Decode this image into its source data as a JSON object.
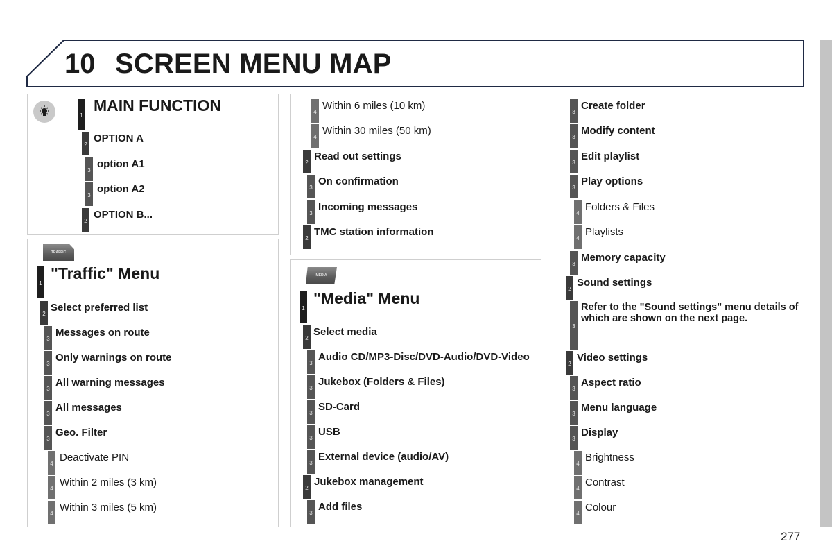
{
  "header": {
    "chapter_number": "10",
    "title": "SCREEN MENU MAP"
  },
  "legend_panel": {
    "icon": "lightbulb-icon",
    "items": [
      {
        "level": "1",
        "label": "MAIN FUNCTION"
      },
      {
        "level": "2",
        "label": "OPTION A"
      },
      {
        "level": "3",
        "label": "option A1"
      },
      {
        "level": "3",
        "label": "option A2"
      },
      {
        "level": "2",
        "label": "OPTION B..."
      }
    ]
  },
  "traffic_panel": {
    "badge": "TRAFFIC",
    "items": [
      {
        "level": "1",
        "label": "\"Traffic\" Menu"
      },
      {
        "level": "2",
        "label": "Select preferred list"
      },
      {
        "level": "3",
        "label": "Messages on route"
      },
      {
        "level": "3",
        "label": "Only warnings on route"
      },
      {
        "level": "3",
        "label": "All warning messages"
      },
      {
        "level": "3",
        "label": "All messages"
      },
      {
        "level": "3",
        "label": "Geo. Filter"
      },
      {
        "level": "4",
        "label": "Deactivate PIN"
      },
      {
        "level": "4",
        "label": "Within 2 miles (3 km)"
      },
      {
        "level": "4",
        "label": "Within 3 miles (5 km)"
      }
    ]
  },
  "traffic_cont_panel": {
    "items": [
      {
        "level": "4",
        "label": "Within 6 miles (10 km)"
      },
      {
        "level": "4",
        "label": "Within 30 miles (50 km)"
      },
      {
        "level": "2",
        "label": "Read out settings"
      },
      {
        "level": "3",
        "label": "On confirmation"
      },
      {
        "level": "3",
        "label": "Incoming messages"
      },
      {
        "level": "2",
        "label": "TMC station information"
      }
    ]
  },
  "media_panel": {
    "badge": "MEDIA",
    "items": [
      {
        "level": "1",
        "label": "\"Media\" Menu"
      },
      {
        "level": "2",
        "label": "Select media"
      },
      {
        "level": "3",
        "label": "Audio CD/MP3-Disc/DVD-Audio/DVD-Video"
      },
      {
        "level": "3",
        "label": "Jukebox (Folders & Files)"
      },
      {
        "level": "3",
        "label": "SD-Card"
      },
      {
        "level": "3",
        "label": "USB"
      },
      {
        "level": "3",
        "label": "External device (audio/AV)"
      },
      {
        "level": "2",
        "label": "Jukebox management"
      },
      {
        "level": "3",
        "label": "Add files"
      }
    ]
  },
  "media_cont_panel": {
    "items": [
      {
        "level": "3",
        "label": "Create folder"
      },
      {
        "level": "3",
        "label": "Modify content"
      },
      {
        "level": "3",
        "label": "Edit playlist"
      },
      {
        "level": "3",
        "label": "Play options"
      },
      {
        "level": "4",
        "label": "Folders & Files"
      },
      {
        "level": "4",
        "label": "Playlists"
      },
      {
        "level": "3",
        "label": "Memory capacity"
      },
      {
        "level": "2",
        "label": "Sound settings"
      },
      {
        "level": "3",
        "label": "Refer to the \"Sound settings\" menu details of which are shown on the next page."
      },
      {
        "level": "2",
        "label": "Video settings"
      },
      {
        "level": "3",
        "label": "Aspect ratio"
      },
      {
        "level": "3",
        "label": "Menu language"
      },
      {
        "level": "3",
        "label": "Display"
      },
      {
        "level": "4",
        "label": "Brightness"
      },
      {
        "level": "4",
        "label": "Contrast"
      },
      {
        "level": "4",
        "label": "Colour"
      }
    ]
  },
  "footer": {
    "page_number": "277"
  }
}
